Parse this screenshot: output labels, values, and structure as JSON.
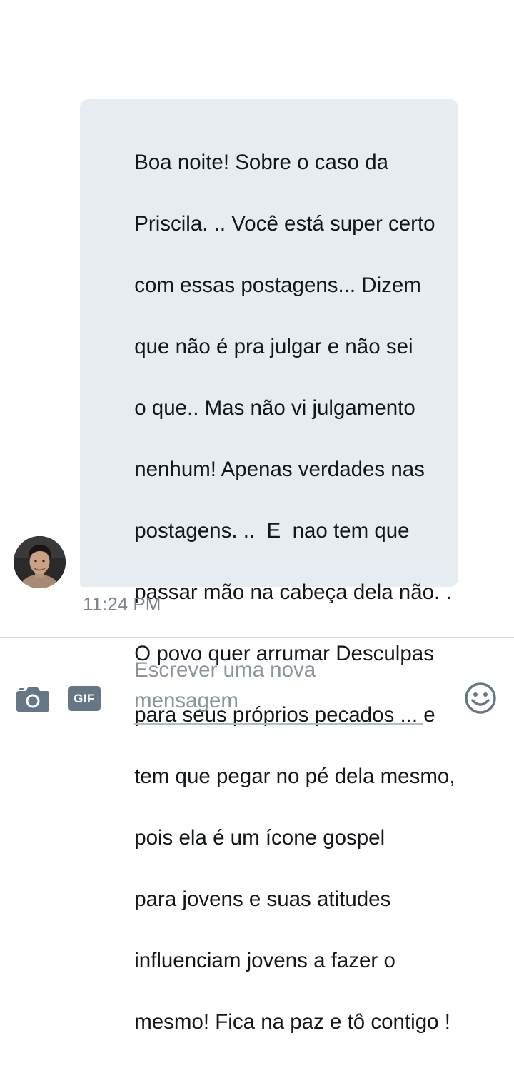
{
  "conversation": {
    "message": {
      "text_lines": [
        "Boa noite! Sobre o caso da",
        "Priscila. .. Você está super certo",
        "com essas postagens... Dizem",
        "que não é pra julgar e não sei",
        "o que.. Mas não vi julgamento",
        "nenhum! Apenas verdades nas",
        "postagens. ..  E  nao tem que",
        "passar mão na cabeça dela não. .",
        "O povo quer arrumar Desculpas",
        "para seus próprios pecados ... e",
        "tem que pegar no pé dela mesmo,",
        "pois ela é um ícone gospel",
        "para jovens e suas atitudes",
        "influenciam jovens a fazer o",
        "mesmo! Fica na paz e tô contigo !"
      ],
      "timestamp": "11:24 PM",
      "bubble_color": "#e6ecf0"
    },
    "sender_avatar_icon": "user-avatar"
  },
  "composer": {
    "camera_icon": "camera-icon",
    "gif_label": "GIF",
    "input_value": "",
    "input_placeholder": "Escrever uma nova mensagem",
    "emoji_icon": "smiley-face-icon",
    "icon_color": "#657786"
  }
}
